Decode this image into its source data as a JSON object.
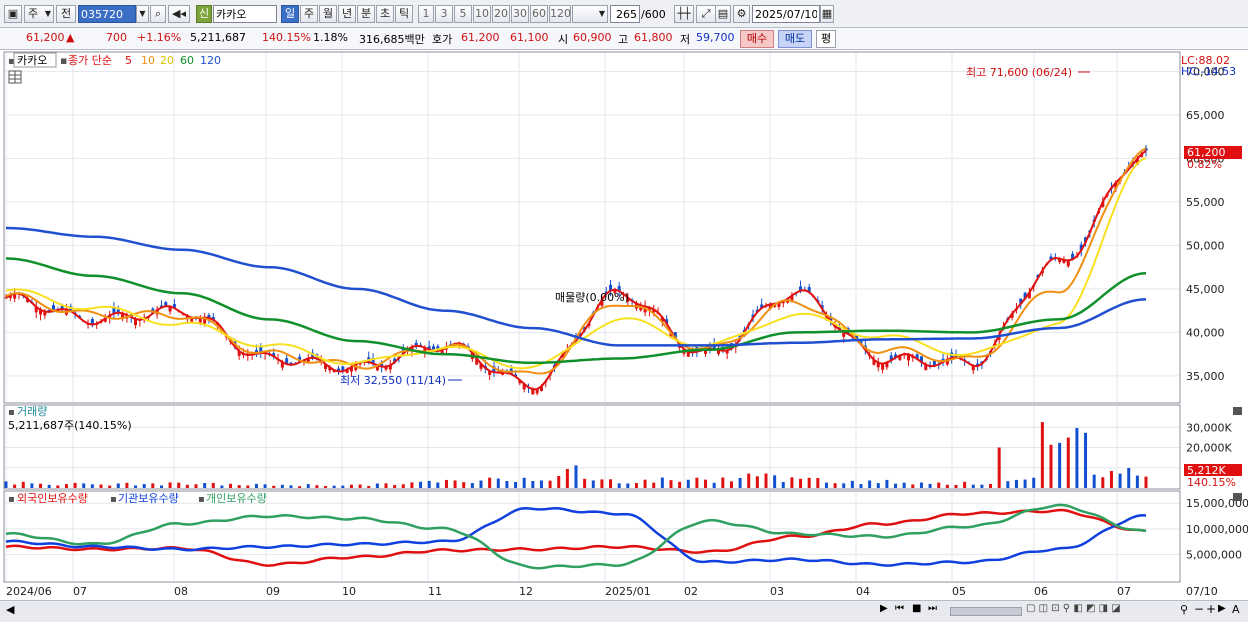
{
  "toolbar": {
    "market": "주",
    "prev": "전",
    "code": "035720",
    "credit": "신",
    "name": "카카오",
    "periods": [
      "일",
      "주",
      "월",
      "년",
      "분",
      "초",
      "틱"
    ],
    "active_period": "일",
    "intervals": [
      "1",
      "3",
      "5",
      "10",
      "20",
      "30",
      "60",
      "120"
    ],
    "count": "265",
    "count_total": "/600",
    "date": "2025/07/10"
  },
  "quote": {
    "price": "61,200",
    "arrow": "▲",
    "change": "700",
    "change_pct": "+1.16%",
    "volume": "5,211,687",
    "volume_ratio": "140.15%",
    "turnover": "1.18%",
    "amount": "316,685백만",
    "ask_label": "호가",
    "ask": "61,200",
    "bid": "61,100",
    "open_label": "시",
    "open": "60,900",
    "high_label": "고",
    "high": "61,800",
    "low_label": "저",
    "low": "59,700",
    "buy": "매수",
    "sell": "매도",
    "eval": "평"
  },
  "price_panel": {
    "stock_label": "카카오",
    "ma_prefix": "종가 단순",
    "ma_periods": [
      "5",
      "10",
      "20",
      "60",
      "120"
    ],
    "lc": "LC:88.02",
    "hc": "HC:-14.53",
    "high_note": "최고 71,600 (06/24)",
    "low_note": "최저 32,550 (11/14)",
    "balloon": "매물량(0.00%)",
    "current_tag": "61,200",
    "current_pct": "0.82%",
    "y_ticks": [
      "70,000",
      "65,000",
      "60,000",
      "55,000",
      "50,000",
      "45,000",
      "40,000",
      "35,000"
    ]
  },
  "volume_panel": {
    "title": "거래량",
    "value": "5,211,687주(140.15%)",
    "y_ticks": [
      "30,000K",
      "20,000K",
      "10,000K"
    ],
    "tag": "5,212K",
    "tag_pct": "140.15%"
  },
  "holding_panel": {
    "series": [
      "외국인보유수량",
      "기관보유수량",
      "개인보유수량"
    ],
    "y_ticks": [
      "15,000,000",
      "10,000,000",
      "5,000,000"
    ]
  },
  "x_axis": {
    "labels": [
      "2024/06",
      "07",
      "08",
      "09",
      "10",
      "11",
      "12",
      "2025/01",
      "02",
      "03",
      "04",
      "05",
      "06",
      "07"
    ],
    "last": "07/10"
  },
  "colors": {
    "ma5": "#e01010",
    "ma10": "#f09010",
    "ma20": "#f8e020",
    "ma60": "#10902a",
    "ma120": "#2050d0",
    "up": "#e01010",
    "down": "#1050d0",
    "foreign": "#e01010",
    "inst": "#1040e0",
    "indiv": "#30a060"
  },
  "chart_data": {
    "type": "line",
    "title": "",
    "x": [
      "2024/06",
      "07",
      "08",
      "09",
      "10",
      "11",
      "12",
      "2025/01",
      "02",
      "03",
      "04",
      "05",
      "06",
      "07"
    ],
    "series": [
      {
        "name": "종가 단순 5",
        "values": [
          44000,
          41500,
          42500,
          37000,
          36000,
          38500,
          34000,
          44500,
          37500,
          44500,
          37000,
          36500,
          48000,
          60500
        ]
      },
      {
        "name": "종가 단순 10",
        "values": [
          44200,
          42000,
          42000,
          37500,
          36200,
          38400,
          35000,
          43500,
          38000,
          43500,
          38000,
          36800,
          45000,
          61000
        ]
      },
      {
        "name": "종가 단순 20",
        "values": [
          44800,
          42800,
          41000,
          38500,
          36500,
          38200,
          36000,
          41500,
          38500,
          42000,
          39500,
          37500,
          41000,
          60000
        ]
      },
      {
        "name": "종가 단순 60",
        "values": [
          48500,
          46500,
          44500,
          41500,
          39000,
          37500,
          36500,
          37000,
          38000,
          40000,
          40200,
          40000,
          41500,
          46800
        ]
      },
      {
        "name": "종가 단순 120",
        "values": [
          52000,
          51000,
          49500,
          47500,
          45000,
          42500,
          40500,
          38500,
          38500,
          38800,
          39200,
          39300,
          40500,
          43800
        ]
      }
    ],
    "high": {
      "value": 71600,
      "date": "06/24"
    },
    "low": {
      "value": 32550,
      "date": "11/14"
    },
    "ylim": [
      32000,
      72000
    ],
    "volume_ylim": [
      0,
      40000
    ],
    "holding_ylim": [
      0,
      17000000
    ]
  }
}
